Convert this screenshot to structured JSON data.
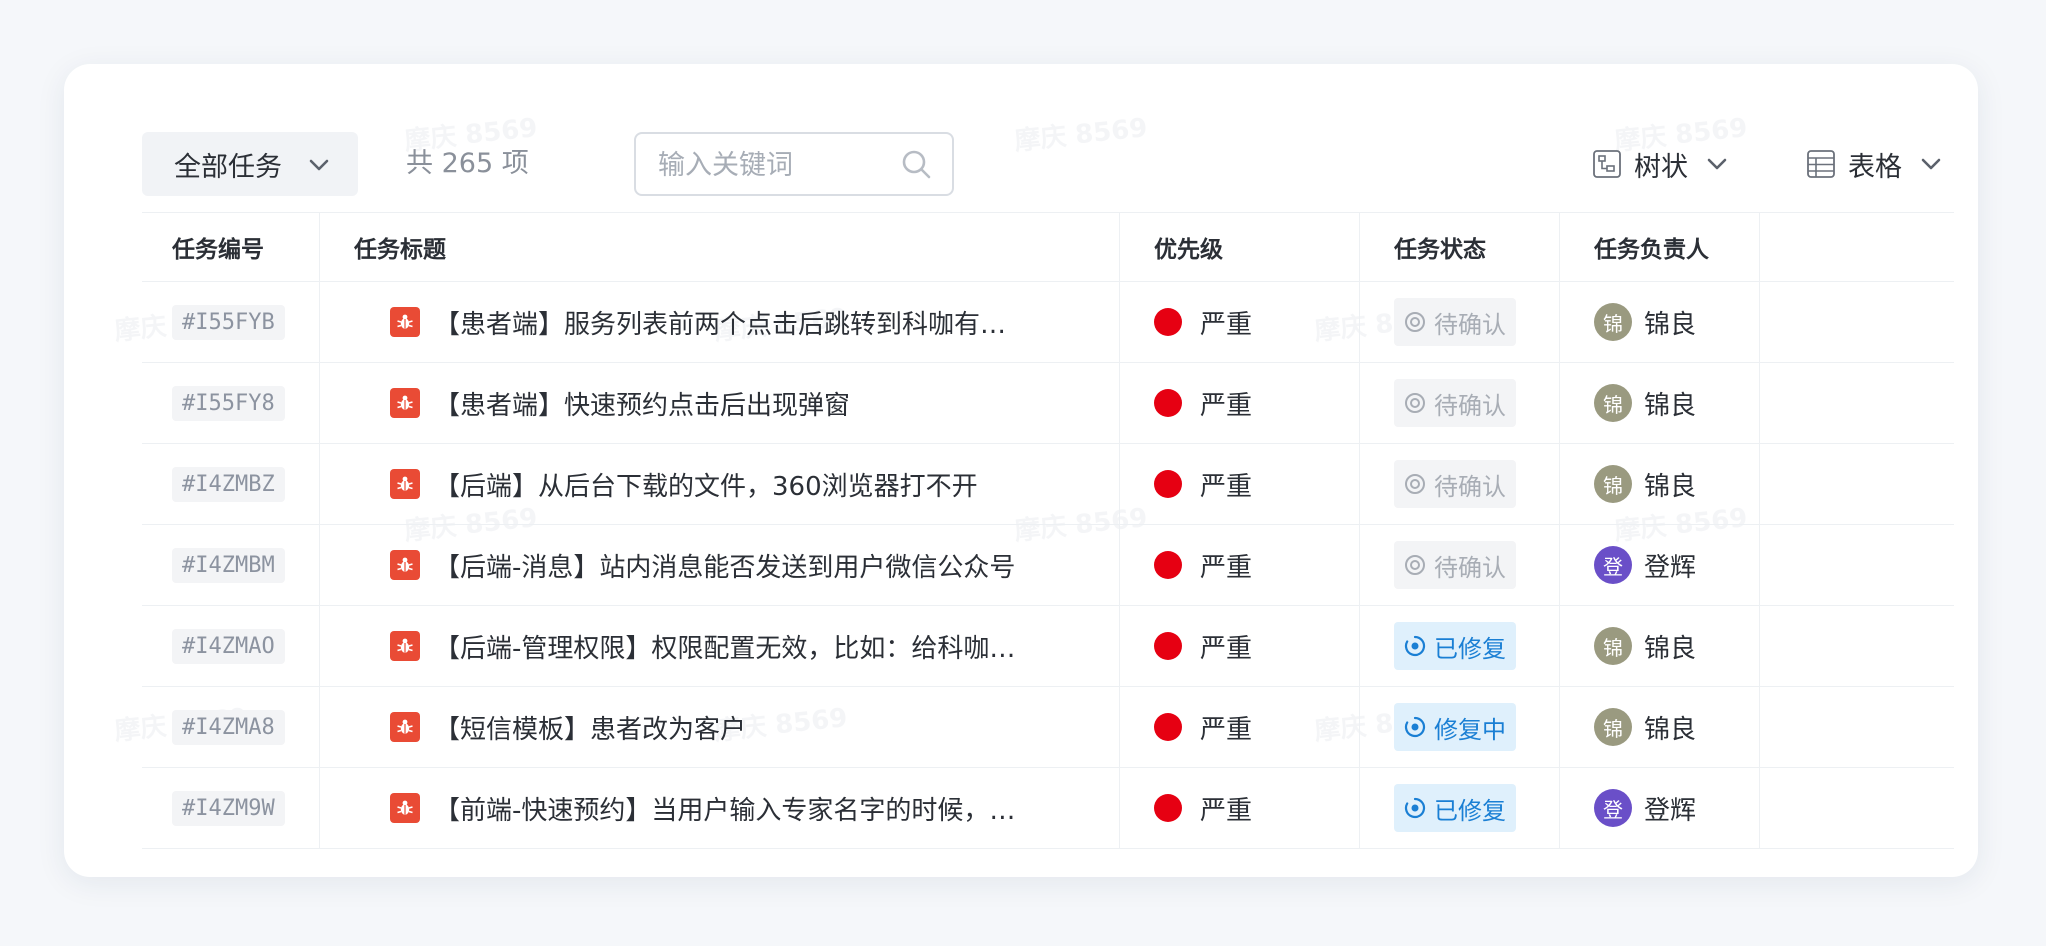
{
  "toolbar": {
    "filter_label": "全部任务",
    "count_text": "共 265 项",
    "search_placeholder": "输入关键词",
    "tree_view_label": "树状",
    "table_view_label": "表格"
  },
  "watermark_text": "摩庆 8569",
  "table": {
    "columns": [
      "任务编号",
      "任务标题",
      "优先级",
      "任务状态",
      "任务负责人"
    ],
    "rows": [
      {
        "id": "#I55FYB",
        "title": "【患者端】服务列表前两个点击后跳转到科咖有…",
        "priority": "严重",
        "status": "待确认",
        "status_type": "pending",
        "owner_initial": "锦",
        "owner": "锦良",
        "avatar_color": "#9a9a80"
      },
      {
        "id": "#I55FY8",
        "title": "【患者端】快速预约点击后出现弹窗",
        "priority": "严重",
        "status": "待确认",
        "status_type": "pending",
        "owner_initial": "锦",
        "owner": "锦良",
        "avatar_color": "#9a9a80"
      },
      {
        "id": "#I4ZMBZ",
        "title": "【后端】从后台下载的文件，360浏览器打不开",
        "priority": "严重",
        "status": "待确认",
        "status_type": "pending",
        "owner_initial": "锦",
        "owner": "锦良",
        "avatar_color": "#9a9a80"
      },
      {
        "id": "#I4ZMBM",
        "title": "【后端-消息】站内消息能否发送到用户微信公众号",
        "priority": "严重",
        "status": "待确认",
        "status_type": "pending",
        "owner_initial": "登",
        "owner": "登辉",
        "avatar_color": "#6a4fc8"
      },
      {
        "id": "#I4ZMAO",
        "title": "【后端-管理权限】权限配置无效，比如：给科咖…",
        "priority": "严重",
        "status": "已修复",
        "status_type": "fixed",
        "owner_initial": "锦",
        "owner": "锦良",
        "avatar_color": "#9a9a80"
      },
      {
        "id": "#I4ZMA8",
        "title": "【短信模板】患者改为客户",
        "priority": "严重",
        "status": "修复中",
        "status_type": "fixing",
        "owner_initial": "锦",
        "owner": "锦良",
        "avatar_color": "#9a9a80"
      },
      {
        "id": "#I4ZM9W",
        "title": "【前端-快速预约】当用户输入专家名字的时候，…",
        "priority": "严重",
        "status": "已修复",
        "status_type": "fixed",
        "owner_initial": "登",
        "owner": "登辉",
        "avatar_color": "#6a4fc8"
      }
    ]
  },
  "colors": {
    "priority_critical": "#e60012",
    "bug_icon": "#e94b35",
    "status_blue": "#1a7fd4",
    "status_gray": "#a8adb5"
  }
}
